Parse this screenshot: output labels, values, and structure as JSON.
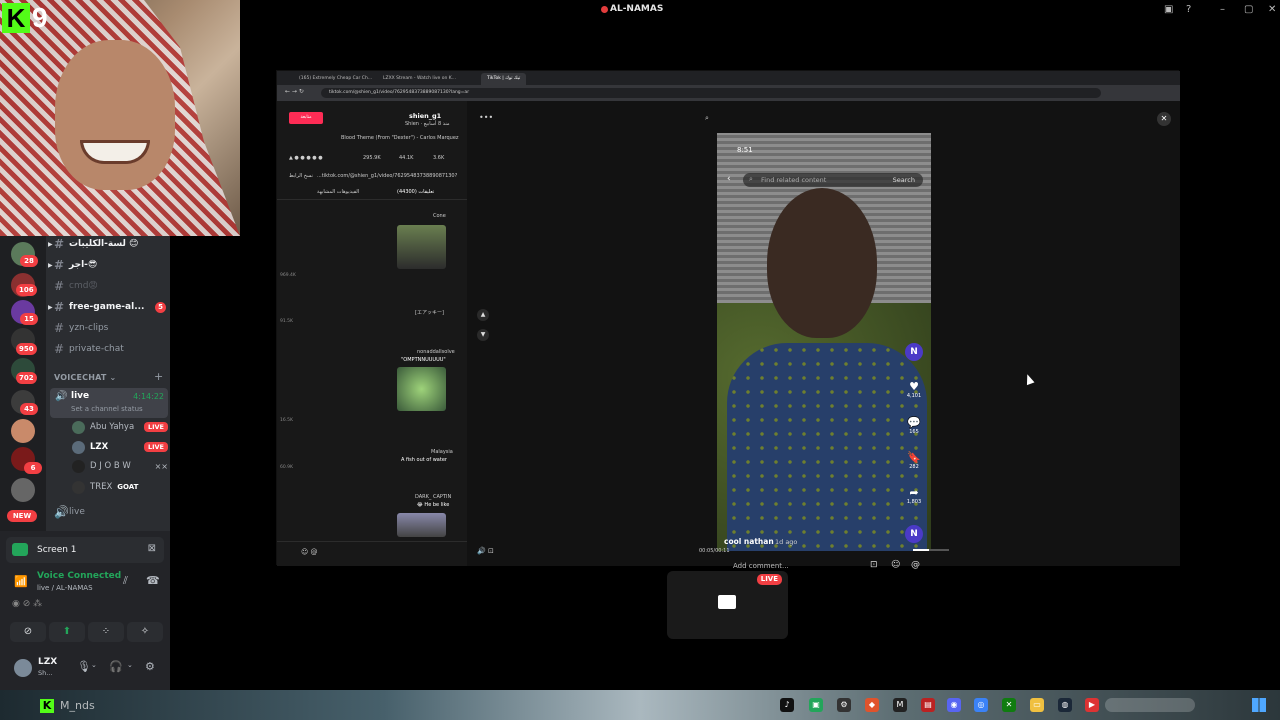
{
  "window": {
    "title": "AL-NAMAS"
  },
  "overlay": {
    "badge_letter": "K",
    "badge_number": "9"
  },
  "servers": [
    {
      "badge": "28"
    },
    {
      "badge": "106"
    },
    {
      "badge": "15"
    },
    {
      "badge": "950"
    },
    {
      "badge": "702"
    },
    {
      "badge": "43"
    },
    {
      "badge": ""
    },
    {
      "badge": "6"
    },
    {
      "badge": ""
    }
  ],
  "new_label": "NEW",
  "channels": [
    {
      "name": "لسة-الكليبات 😊",
      "style": "bold"
    },
    {
      "name": "اجر-😎",
      "style": "bold"
    },
    {
      "name": "cmd😡",
      "style": "dim"
    },
    {
      "name": "free-game-al...",
      "style": "bold",
      "badge": "5"
    },
    {
      "name": "yzn-clips",
      "style": "normal"
    },
    {
      "name": "private-chat",
      "style": "normal"
    }
  ],
  "voice": {
    "header": "VOICECHAT",
    "channel": "live",
    "elapsed": "4:14:22",
    "status_placeholder": "Set a channel status",
    "users": [
      {
        "name": "Abu Yahya",
        "live": "LIVE"
      },
      {
        "name": "LZX",
        "live": "LIVE"
      },
      {
        "name": "D J O B W",
        "live": ""
      },
      {
        "name": "TREX",
        "tag": "GOAT"
      }
    ],
    "second_channel": "live"
  },
  "panel": {
    "screen_label": "Screen 1",
    "connected": "Voice Connected",
    "location": "live / AL-NAMAS",
    "user_name": "LZX",
    "user_sub": "Sh..."
  },
  "shared": {
    "tabs": [
      "(165) Extremely Cheap Car Ch...",
      "LZXX Stream - Watch live on K...",
      "TikTok | تيك توك"
    ],
    "url": "tiktok.com/@shien_g1/video/7629548373889087130?lang=ar",
    "comments": {
      "author": "shien_g1",
      "author_sub": "Shien · منذ 8 أسابيع",
      "music": "Blood Theme (From \"Dexter\") - Carlos Marquez",
      "stats": [
        "295.9K",
        "44.1K",
        "3.6K"
      ],
      "link": "...tiktok.com/@shien_g1/video/7629548373889087130?is_from_webapp=1&sender_device=pc&web_id=7546483488...",
      "copy_label": "نسخ الرابط",
      "tab_left": "الفيديوهات المشابهة",
      "tab_right": "تعليقات (44300)",
      "items": [
        {
          "user": "Cone",
          "text": "",
          "likes": "969.4K"
        },
        {
          "user": "[エアッキー]",
          "text": "",
          "likes": "91.5K"
        },
        {
          "user": "nonaddallsolve",
          "text": "\"OMPTNNUUUUU\"",
          "likes": ""
        },
        {
          "user": "Malaysia",
          "text": "A fish out of water",
          "likes": "16.5K"
        },
        {
          "user": "DARK_ CAPTIN",
          "text": "😂 He be like",
          "likes": "60.9K"
        }
      ]
    },
    "video": {
      "time": "8:51",
      "search_placeholder": "Find related content",
      "search_button": "Search",
      "side": [
        {
          "icon": "heart-icon",
          "count": "4,101"
        },
        {
          "icon": "comment-icon",
          "count": "165"
        },
        {
          "icon": "bookmark-icon",
          "count": "282"
        },
        {
          "icon": "share-icon",
          "count": "1,803"
        }
      ],
      "author": "cool nathan",
      "ago": "1d ago",
      "avatar_letter": "N",
      "progress": "00:05/00:11",
      "progress_fraction": 0.45
    },
    "add_comment_placeholder": "Add comment..."
  },
  "stream_tile": {
    "live": "LIVE"
  },
  "taskbar": {
    "brand": "M_nds"
  }
}
